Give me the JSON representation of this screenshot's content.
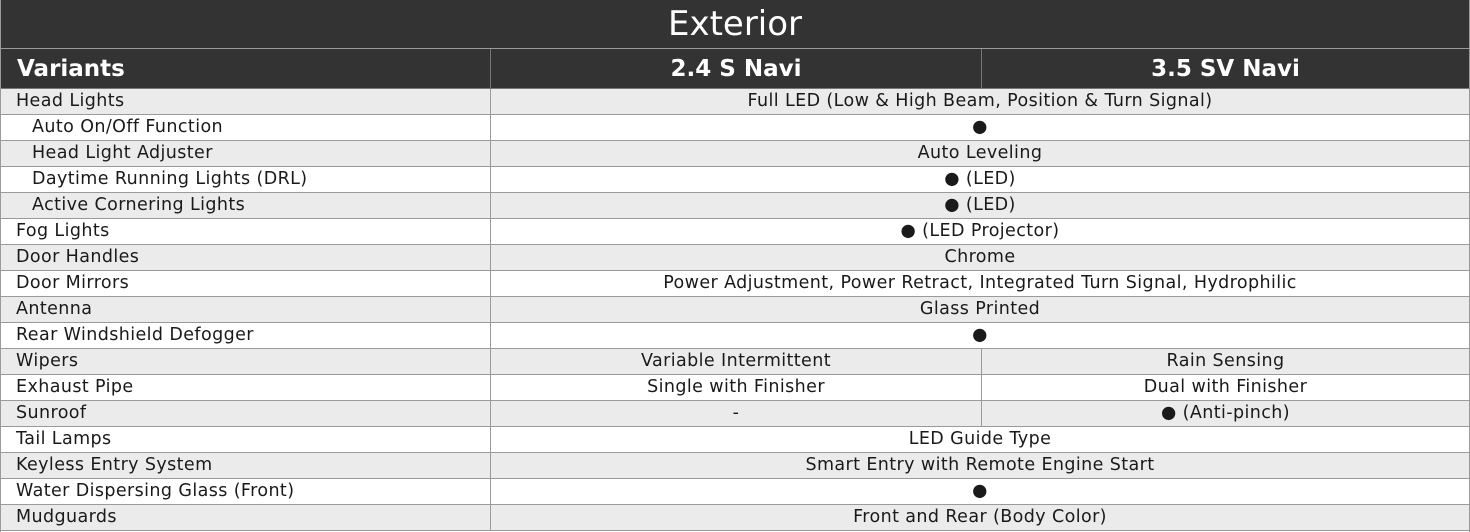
{
  "title": "Exterior",
  "header": {
    "col0": "Variants",
    "col1": "2.4 S Navi",
    "col2": "3.5 SV Navi"
  },
  "rows": [
    {
      "label": "Head Lights",
      "indent": false,
      "span": "Full LED (Low & High Beam, Position & Turn Signal)"
    },
    {
      "label": "Auto On/Off Function",
      "indent": true,
      "span": "●"
    },
    {
      "label": "Head Light Adjuster",
      "indent": true,
      "span": "Auto Leveling"
    },
    {
      "label": "Daytime Running Lights (DRL)",
      "indent": true,
      "span": "●  (LED)"
    },
    {
      "label": "Active Cornering Lights",
      "indent": true,
      "span": "●  (LED)"
    },
    {
      "label": "Fog Lights",
      "indent": false,
      "span": "●  (LED Projector)"
    },
    {
      "label": "Door Handles",
      "indent": false,
      "span": "Chrome"
    },
    {
      "label": "Door Mirrors",
      "indent": false,
      "span": "Power Adjustment, Power Retract, Integrated Turn Signal, Hydrophilic"
    },
    {
      "label": "Antenna",
      "indent": false,
      "span": "Glass Printed"
    },
    {
      "label": "Rear Windshield Defogger",
      "indent": false,
      "span": "●"
    },
    {
      "label": "Wipers",
      "indent": false,
      "a": "Variable Intermittent",
      "b": "Rain Sensing"
    },
    {
      "label": "Exhaust Pipe",
      "indent": false,
      "a": "Single with Finisher",
      "b": "Dual with Finisher"
    },
    {
      "label": "Sunroof",
      "indent": false,
      "a": "-",
      "b": "●  (Anti-pinch)"
    },
    {
      "label": "Tail Lamps",
      "indent": false,
      "span": "LED Guide Type"
    },
    {
      "label": "Keyless Entry System",
      "indent": false,
      "span": "Smart Entry with Remote Engine Start"
    },
    {
      "label": "Water Dispersing Glass (Front)",
      "indent": false,
      "span": "●"
    },
    {
      "label": "Mudguards",
      "indent": false,
      "span": "Front and Rear (Body Color)"
    }
  ],
  "colors": {
    "header_bg": "#333333",
    "row_alt": "#ebebeb",
    "row_base": "#ffffff",
    "grid": "#9a9a9a"
  }
}
